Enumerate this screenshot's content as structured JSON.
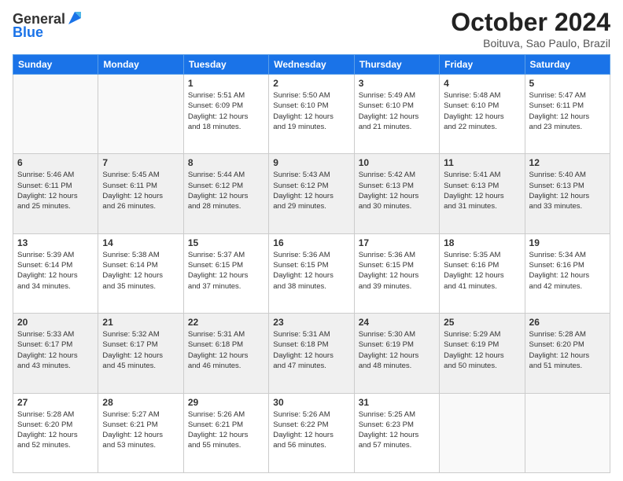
{
  "header": {
    "logo_general": "General",
    "logo_blue": "Blue",
    "title": "October 2024",
    "subtitle": "Boituva, Sao Paulo, Brazil"
  },
  "columns": [
    "Sunday",
    "Monday",
    "Tuesday",
    "Wednesday",
    "Thursday",
    "Friday",
    "Saturday"
  ],
  "weeks": [
    [
      {
        "day": null
      },
      {
        "day": null
      },
      {
        "day": "1",
        "sunrise": "5:51 AM",
        "sunset": "6:09 PM",
        "daylight": "12 hours and 18 minutes."
      },
      {
        "day": "2",
        "sunrise": "5:50 AM",
        "sunset": "6:10 PM",
        "daylight": "12 hours and 19 minutes."
      },
      {
        "day": "3",
        "sunrise": "5:49 AM",
        "sunset": "6:10 PM",
        "daylight": "12 hours and 21 minutes."
      },
      {
        "day": "4",
        "sunrise": "5:48 AM",
        "sunset": "6:10 PM",
        "daylight": "12 hours and 22 minutes."
      },
      {
        "day": "5",
        "sunrise": "5:47 AM",
        "sunset": "6:11 PM",
        "daylight": "12 hours and 23 minutes."
      }
    ],
    [
      {
        "day": "6",
        "sunrise": "5:46 AM",
        "sunset": "6:11 PM",
        "daylight": "12 hours and 25 minutes."
      },
      {
        "day": "7",
        "sunrise": "5:45 AM",
        "sunset": "6:11 PM",
        "daylight": "12 hours and 26 minutes."
      },
      {
        "day": "8",
        "sunrise": "5:44 AM",
        "sunset": "6:12 PM",
        "daylight": "12 hours and 28 minutes."
      },
      {
        "day": "9",
        "sunrise": "5:43 AM",
        "sunset": "6:12 PM",
        "daylight": "12 hours and 29 minutes."
      },
      {
        "day": "10",
        "sunrise": "5:42 AM",
        "sunset": "6:13 PM",
        "daylight": "12 hours and 30 minutes."
      },
      {
        "day": "11",
        "sunrise": "5:41 AM",
        "sunset": "6:13 PM",
        "daylight": "12 hours and 31 minutes."
      },
      {
        "day": "12",
        "sunrise": "5:40 AM",
        "sunset": "6:13 PM",
        "daylight": "12 hours and 33 minutes."
      }
    ],
    [
      {
        "day": "13",
        "sunrise": "5:39 AM",
        "sunset": "6:14 PM",
        "daylight": "12 hours and 34 minutes."
      },
      {
        "day": "14",
        "sunrise": "5:38 AM",
        "sunset": "6:14 PM",
        "daylight": "12 hours and 35 minutes."
      },
      {
        "day": "15",
        "sunrise": "5:37 AM",
        "sunset": "6:15 PM",
        "daylight": "12 hours and 37 minutes."
      },
      {
        "day": "16",
        "sunrise": "5:36 AM",
        "sunset": "6:15 PM",
        "daylight": "12 hours and 38 minutes."
      },
      {
        "day": "17",
        "sunrise": "5:36 AM",
        "sunset": "6:15 PM",
        "daylight": "12 hours and 39 minutes."
      },
      {
        "day": "18",
        "sunrise": "5:35 AM",
        "sunset": "6:16 PM",
        "daylight": "12 hours and 41 minutes."
      },
      {
        "day": "19",
        "sunrise": "5:34 AM",
        "sunset": "6:16 PM",
        "daylight": "12 hours and 42 minutes."
      }
    ],
    [
      {
        "day": "20",
        "sunrise": "5:33 AM",
        "sunset": "6:17 PM",
        "daylight": "12 hours and 43 minutes."
      },
      {
        "day": "21",
        "sunrise": "5:32 AM",
        "sunset": "6:17 PM",
        "daylight": "12 hours and 45 minutes."
      },
      {
        "day": "22",
        "sunrise": "5:31 AM",
        "sunset": "6:18 PM",
        "daylight": "12 hours and 46 minutes."
      },
      {
        "day": "23",
        "sunrise": "5:31 AM",
        "sunset": "6:18 PM",
        "daylight": "12 hours and 47 minutes."
      },
      {
        "day": "24",
        "sunrise": "5:30 AM",
        "sunset": "6:19 PM",
        "daylight": "12 hours and 48 minutes."
      },
      {
        "day": "25",
        "sunrise": "5:29 AM",
        "sunset": "6:19 PM",
        "daylight": "12 hours and 50 minutes."
      },
      {
        "day": "26",
        "sunrise": "5:28 AM",
        "sunset": "6:20 PM",
        "daylight": "12 hours and 51 minutes."
      }
    ],
    [
      {
        "day": "27",
        "sunrise": "5:28 AM",
        "sunset": "6:20 PM",
        "daylight": "12 hours and 52 minutes."
      },
      {
        "day": "28",
        "sunrise": "5:27 AM",
        "sunset": "6:21 PM",
        "daylight": "12 hours and 53 minutes."
      },
      {
        "day": "29",
        "sunrise": "5:26 AM",
        "sunset": "6:21 PM",
        "daylight": "12 hours and 55 minutes."
      },
      {
        "day": "30",
        "sunrise": "5:26 AM",
        "sunset": "6:22 PM",
        "daylight": "12 hours and 56 minutes."
      },
      {
        "day": "31",
        "sunrise": "5:25 AM",
        "sunset": "6:23 PM",
        "daylight": "12 hours and 57 minutes."
      },
      {
        "day": null
      },
      {
        "day": null
      }
    ]
  ],
  "labels": {
    "sunrise": "Sunrise:",
    "sunset": "Sunset:",
    "daylight": "Daylight:"
  }
}
